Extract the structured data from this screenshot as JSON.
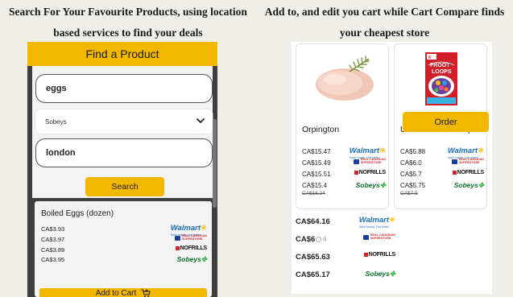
{
  "captions": {
    "left": "Search For Your Favourite Products, using location based services to find your deals",
    "right": "Add to, and edit you cart while Cart Compare finds your cheapest store"
  },
  "search_screen": {
    "header_title": "Find a Product",
    "query_value": "eggs",
    "store_selected": "Sobeys",
    "location_value": "london",
    "search_label": "Search",
    "result": {
      "title": "Boiled Eggs (dozen)",
      "rows": [
        {
          "price": "CA$3.93",
          "store": "walmart"
        },
        {
          "price": "CA$3.97",
          "store": "real-canadian-superstore"
        },
        {
          "price": "CA$3.89",
          "store": "nofrills"
        },
        {
          "price": "CA$3.95",
          "store": "sobeys"
        }
      ],
      "add_label": "Add to Cart"
    }
  },
  "cart_screen": {
    "products": [
      {
        "name": "Orpington",
        "image_icon": "chicken-icon",
        "rows": [
          {
            "price": "CA$15.47",
            "store": "walmart"
          },
          {
            "price": "CA$15.49",
            "store": "real-canadian-superstore"
          },
          {
            "price": "CA$15.51",
            "store": "nofrills"
          },
          {
            "price": "CA$15.4",
            "store": "sobeys"
          }
        ],
        "original_price": "CA$16.24"
      },
      {
        "name": "Unicorn Froot Loops",
        "image_icon": "cereal-box-icon",
        "rows": [
          {
            "price": "CA$5.88",
            "store": "walmart"
          },
          {
            "price": "CA$6.0",
            "store": "real-canadian-superstore"
          },
          {
            "price": "CA$5.7",
            "store": "nofrills"
          },
          {
            "price": "CA$5.75",
            "store": "sobeys"
          }
        ],
        "original_price": "CA$7.5"
      }
    ],
    "totals": [
      {
        "price": "CA$64.16",
        "store": "walmart"
      },
      {
        "price_prefix": "CA$6",
        "price_suffix": "4",
        "store": "real-canadian-superstore"
      },
      {
        "price": "CA$65.63",
        "store": "nofrills"
      },
      {
        "price": "CA$65.17",
        "store": "sobeys"
      }
    ],
    "order_label": "Order"
  },
  "store_logos": {
    "walmart": {
      "text": "Walmart",
      "tagline": "Save money. Live better."
    },
    "superstore": {
      "line1": "REAL CANADIAN",
      "line2": "SUPERSTORE"
    },
    "nofrills": {
      "text": "NOFRILLS"
    },
    "sobeys": {
      "text": "Sobeys"
    }
  },
  "colors": {
    "accent": "#f2b800",
    "background": "#efeee8",
    "phone_dark": "#3e3e3e",
    "walmart_blue": "#1b6fc1",
    "walmart_spark": "#ffc220",
    "superstore_red": "#d1232a",
    "sobeys_green": "#0b6b2b"
  }
}
